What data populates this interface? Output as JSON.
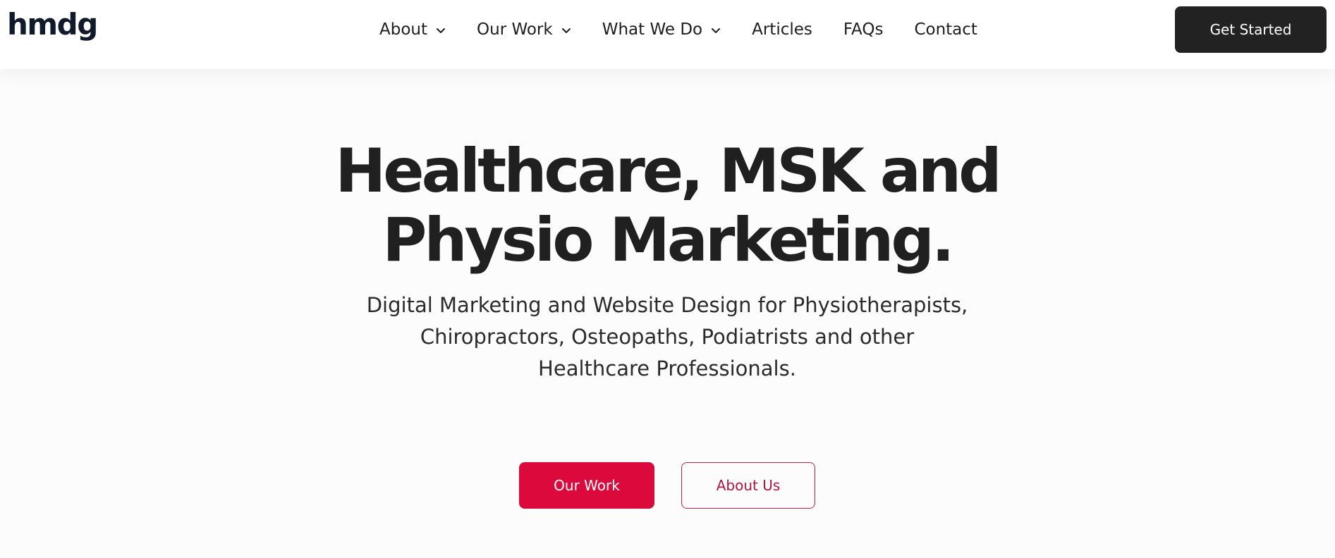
{
  "header": {
    "logo": "hmdg",
    "nav": [
      {
        "label": "About",
        "has_dropdown": true,
        "icon": "chevron-down-icon"
      },
      {
        "label": "Our Work",
        "has_dropdown": true,
        "icon": "chevron-down-icon"
      },
      {
        "label": "What We Do",
        "has_dropdown": true,
        "icon": "chevron-down-icon"
      },
      {
        "label": "Articles",
        "has_dropdown": false
      },
      {
        "label": "FAQs",
        "has_dropdown": false
      },
      {
        "label": "Contact",
        "has_dropdown": false
      }
    ],
    "cta_label": "Get Started"
  },
  "hero": {
    "title_line1": "Healthcare, MSK and",
    "title_line2": "Physio Marketing.",
    "subtitle_line1": "Digital Marketing and Website Design for Physiotherapists,",
    "subtitle_line2": "Chiropractors, Osteopaths, Podiatrists and other",
    "subtitle_line3": "Healthcare Professionals.",
    "primary_button": "Our Work",
    "secondary_button": "About Us"
  },
  "colors": {
    "accent": "#dc0a3c",
    "dark_button": "#222222",
    "text": "#202020",
    "logo": "#0f1a2a"
  }
}
